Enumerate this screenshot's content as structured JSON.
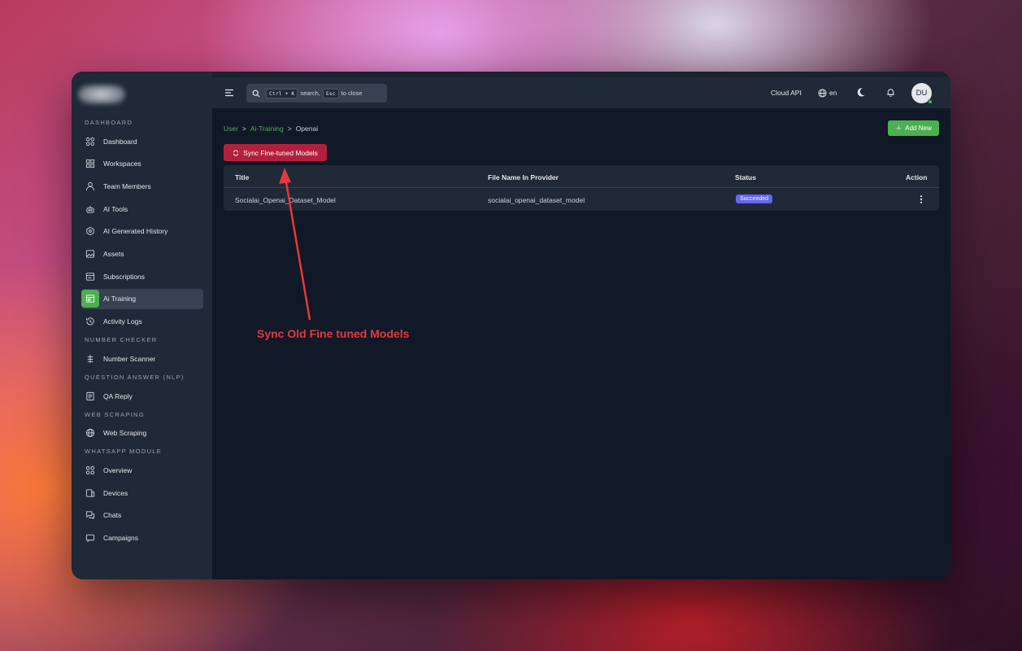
{
  "sidebar": {
    "sections": [
      {
        "title": "DASHBOARD",
        "items": [
          {
            "label": "Dashboard",
            "icon": "grid-icon"
          },
          {
            "label": "Workspaces",
            "icon": "workspaces-icon"
          },
          {
            "label": "Team Members",
            "icon": "user-icon"
          },
          {
            "label": "AI Tools",
            "icon": "robot-icon"
          },
          {
            "label": "AI Generated History",
            "icon": "ai-history-icon"
          },
          {
            "label": "Assets",
            "icon": "image-icon"
          },
          {
            "label": "Subscriptions",
            "icon": "subscription-icon"
          },
          {
            "label": "Ai Training",
            "icon": "training-icon",
            "active": true
          },
          {
            "label": "Activity Logs",
            "icon": "history-icon"
          }
        ]
      },
      {
        "title": "NUMBER CHECKER",
        "items": [
          {
            "label": "Number Scanner",
            "icon": "scanner-icon"
          }
        ]
      },
      {
        "title": "QUESTION ANSWER (NLP)",
        "items": [
          {
            "label": "QA Reply",
            "icon": "qa-icon"
          }
        ]
      },
      {
        "title": "WEB SCRAPING",
        "items": [
          {
            "label": "Web Scraping",
            "icon": "globe-icon"
          }
        ]
      },
      {
        "title": "WHATSAPP MODULE",
        "items": [
          {
            "label": "Overview",
            "icon": "grid-icon"
          },
          {
            "label": "Devices",
            "icon": "devices-icon"
          },
          {
            "label": "Chats",
            "icon": "chat-icon"
          },
          {
            "label": "Campaigns",
            "icon": "campaign-icon"
          }
        ]
      }
    ]
  },
  "topbar": {
    "search": {
      "kbd1": "Ctrl + K",
      "text1": "search,",
      "kbd2": "Esc",
      "text2": "to close"
    },
    "cloud_api": "Cloud API",
    "language": "en",
    "avatar_initials": "DU"
  },
  "breadcrumb": {
    "items": [
      "User",
      "Ai-Training",
      "Openai"
    ],
    "separator": ">"
  },
  "add_new_label": "Add New",
  "sync_button_label": "Sync Fine-tuned Models",
  "table": {
    "columns": [
      "Title",
      "File Name In Provider",
      "Status",
      "Action"
    ],
    "rows": [
      {
        "title": "Socialai_Openai_Dataset_Model",
        "file_name": "socialai_openai_dataset_model",
        "status": "Succeeded"
      }
    ]
  },
  "annotation": {
    "text": "Sync Old Fine tuned Models",
    "color": "#e5383b"
  },
  "colors": {
    "accent": "#4caf50",
    "danger": "#b3203f",
    "badge": "#6366f1"
  }
}
